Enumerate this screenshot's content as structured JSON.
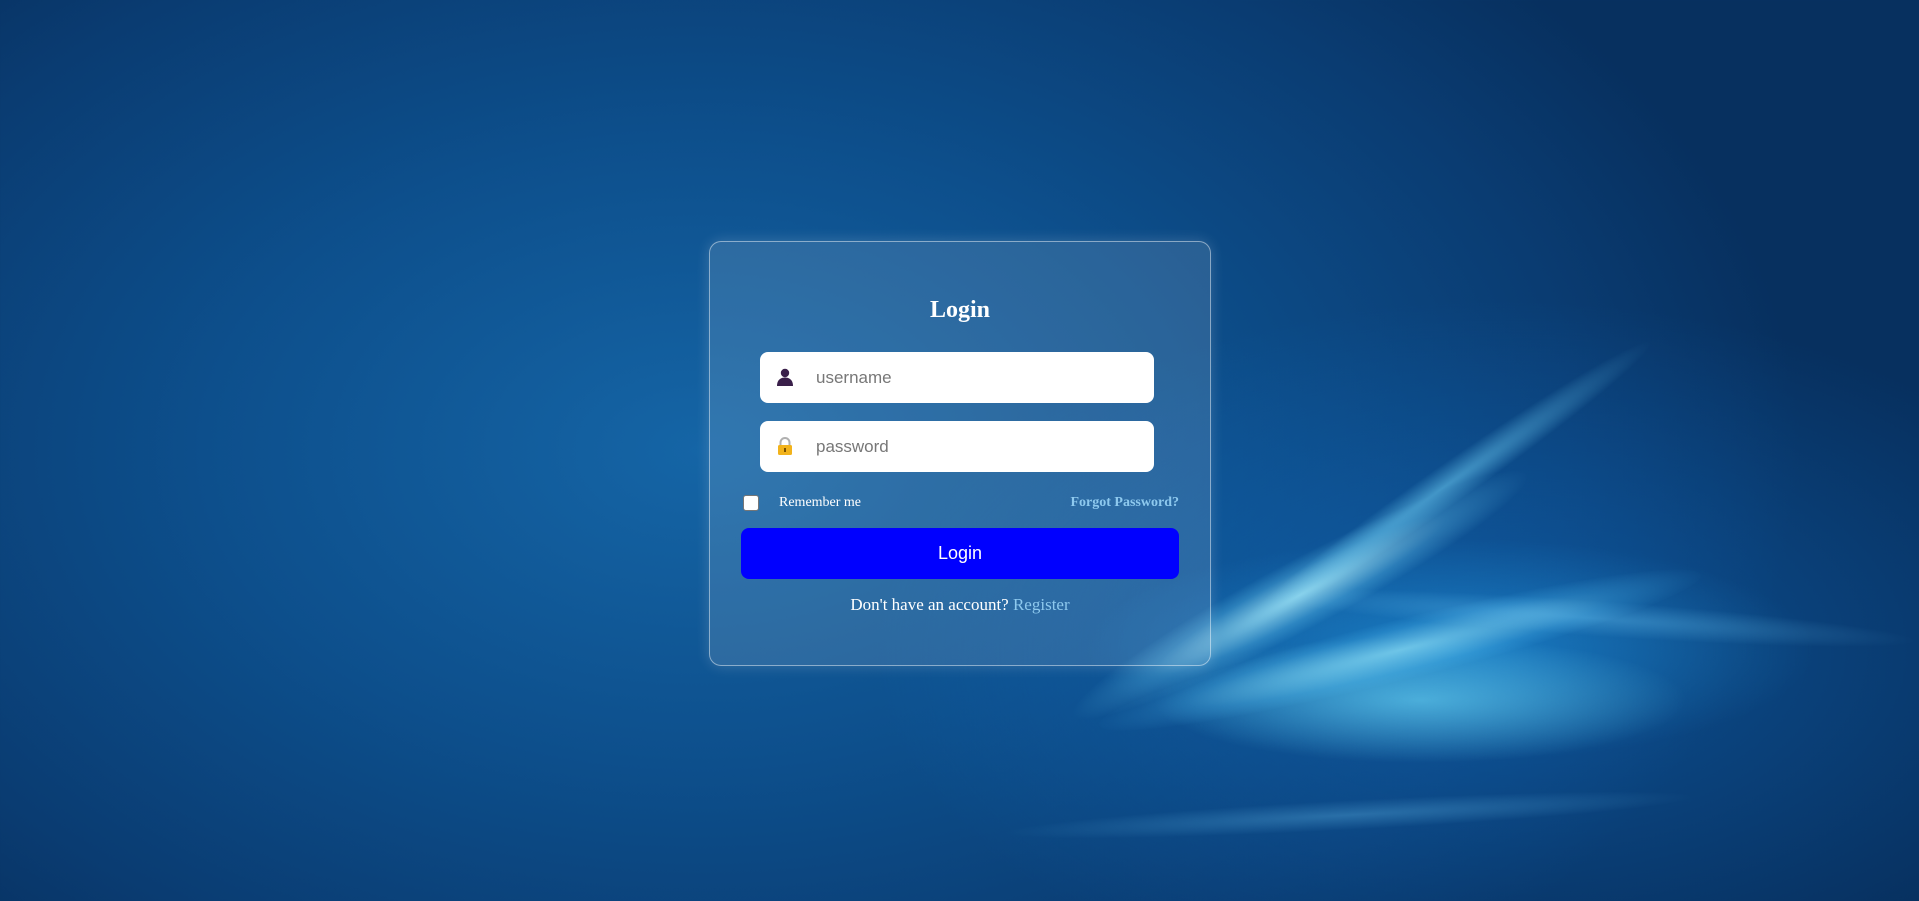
{
  "login": {
    "title": "Login",
    "username": {
      "placeholder": "username",
      "value": "",
      "icon": "user-icon"
    },
    "password": {
      "placeholder": "password",
      "value": "",
      "icon": "lock-icon"
    },
    "remember_me": {
      "label": "Remember me",
      "checked": false
    },
    "forgot_password": "Forgot Password?",
    "submit_label": "Login",
    "register_prompt": "Don't have an account?",
    "register_link": "Register"
  },
  "colors": {
    "button": "#0000ff",
    "link": "#8ec9ee",
    "background": "#0d4f8c"
  }
}
